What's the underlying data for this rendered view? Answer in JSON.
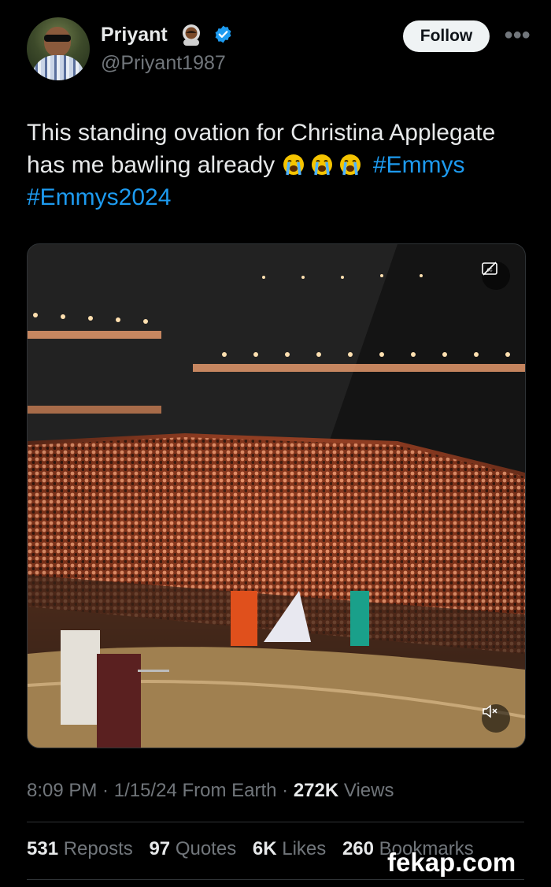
{
  "author": {
    "name": "Priyant",
    "handle": "@Priyant1987",
    "badge_emoji": "astronaut",
    "verified_color": "#1d9bf0"
  },
  "actions": {
    "follow_label": "Follow",
    "more_icon": "more-dots-icon"
  },
  "tweet": {
    "text_line1": "This standing ovation for Christina Applegate",
    "text_line2_prefix": "has me bawling already",
    "emojis": [
      "loudly-crying-face",
      "loudly-crying-face",
      "loudly-crying-face"
    ],
    "hashtag1": "#Emmys",
    "hashtag2": "#Emmys2024",
    "hashtag_color": "#1d9bf0"
  },
  "media": {
    "type": "video",
    "captions_icon": "closed-captions-off-icon",
    "mute_icon": "muted-speaker-icon"
  },
  "meta": {
    "time": "8:09 PM",
    "date": "1/15/24",
    "source": "From Earth",
    "views_count": "272K",
    "views_label": "Views"
  },
  "stats": {
    "reposts_count": "531",
    "reposts_label": "Reposts",
    "quotes_count": "97",
    "quotes_label": "Quotes",
    "likes_count": "6K",
    "likes_label": "Likes",
    "bookmarks_count": "260",
    "bookmarks_label": "Bookmarks"
  },
  "watermark": "fekap.com"
}
